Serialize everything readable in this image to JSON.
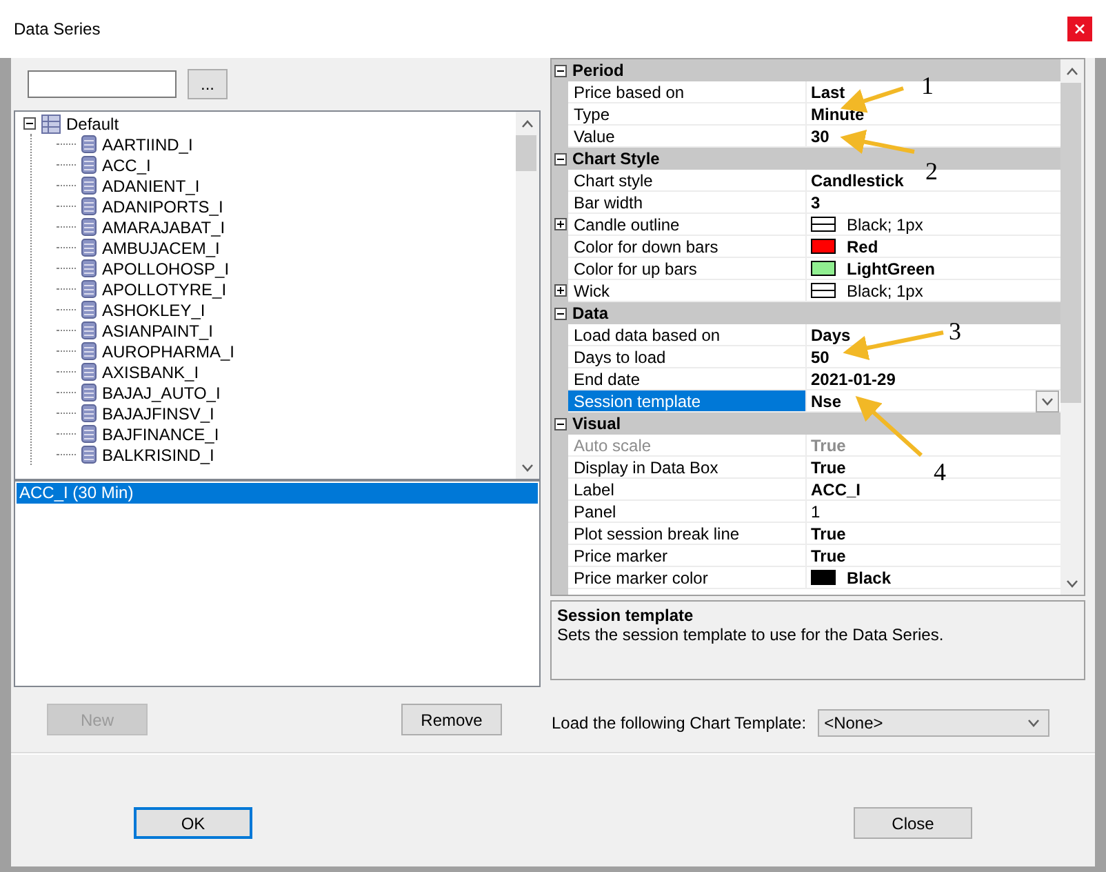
{
  "window": {
    "title": "Data Series"
  },
  "browse_button": "...",
  "tree": {
    "label": "Default",
    "expanded": true,
    "children": [
      {
        "label": "AARTIIND_I"
      },
      {
        "label": "ACC_I"
      },
      {
        "label": "ADANIENT_I"
      },
      {
        "label": "ADANIPORTS_I"
      },
      {
        "label": "AMARAJABAT_I"
      },
      {
        "label": "AMBUJACEM_I"
      },
      {
        "label": "APOLLOHOSP_I"
      },
      {
        "label": "APOLLOTYRE_I"
      },
      {
        "label": "ASHOKLEY_I"
      },
      {
        "label": "ASIANPAINT_I"
      },
      {
        "label": "AUROPHARMA_I"
      },
      {
        "label": "AXISBANK_I"
      },
      {
        "label": "BAJAJ_AUTO_I"
      },
      {
        "label": "BAJAJFINSV_I"
      },
      {
        "label": "BAJFINANCE_I"
      },
      {
        "label": "BALKRISIND_I"
      }
    ]
  },
  "series_list": [
    {
      "label": "ACC_I (30 Min)",
      "selected": true
    }
  ],
  "left_buttons": [
    {
      "label": "New",
      "disabled": true
    },
    {
      "label": "Remove",
      "disabled": false
    }
  ],
  "properties": [
    {
      "category": "Period",
      "expanded": true,
      "rows": [
        {
          "kind": "text",
          "name": "Price based on",
          "value": "Last",
          "bold": true,
          "disabled": false,
          "selected": false
        },
        {
          "kind": "text",
          "name": "Type",
          "value": "Minute",
          "bold": true,
          "disabled": false,
          "selected": false
        },
        {
          "kind": "text",
          "name": "Value",
          "value": "30",
          "bold": true,
          "disabled": false,
          "selected": false
        }
      ]
    },
    {
      "category": "Chart Style",
      "expanded": true,
      "rows": [
        {
          "kind": "text",
          "name": "Chart style",
          "value": "Candlestick",
          "bold": true,
          "disabled": false,
          "selected": false
        },
        {
          "kind": "text",
          "name": "Bar width",
          "value": "3",
          "bold": true,
          "disabled": false,
          "selected": false
        },
        {
          "kind": "pen",
          "name": "Candle outline",
          "value": "Black; 1px",
          "bold": false,
          "disabled": false,
          "selected": false,
          "expanded": false
        },
        {
          "kind": "color",
          "name": "Color for down bars",
          "value": "Red",
          "color": "#ff0000",
          "bold": true,
          "disabled": false,
          "selected": false
        },
        {
          "kind": "color",
          "name": "Color for up bars",
          "value": "LightGreen",
          "color": "#90ee90",
          "bold": true,
          "disabled": false,
          "selected": false
        },
        {
          "kind": "pen",
          "name": "Wick",
          "value": "Black; 1px",
          "bold": false,
          "disabled": false,
          "selected": false,
          "expanded": false
        }
      ]
    },
    {
      "category": "Data",
      "expanded": true,
      "rows": [
        {
          "kind": "text",
          "name": "Load data based on",
          "value": "Days",
          "bold": true,
          "disabled": false,
          "selected": false
        },
        {
          "kind": "text",
          "name": "Days to load",
          "value": "50",
          "bold": true,
          "disabled": false,
          "selected": false
        },
        {
          "kind": "text",
          "name": "End date",
          "value": "2021-01-29",
          "bold": true,
          "disabled": false,
          "selected": false
        },
        {
          "kind": "dropdown",
          "name": "Session template",
          "value": "Nse",
          "bold": true,
          "disabled": false,
          "selected": true
        }
      ]
    },
    {
      "category": "Visual",
      "expanded": true,
      "rows": [
        {
          "kind": "text",
          "name": "Auto scale",
          "value": "True",
          "bold": true,
          "disabled": true,
          "selected": false
        },
        {
          "kind": "text",
          "name": "Display in Data Box",
          "value": "True",
          "bold": true,
          "disabled": false,
          "selected": false
        },
        {
          "kind": "text",
          "name": "Label",
          "value": "ACC_I",
          "bold": true,
          "disabled": false,
          "selected": false
        },
        {
          "kind": "text",
          "name": "Panel",
          "value": "1",
          "bold": false,
          "disabled": false,
          "selected": false
        },
        {
          "kind": "text",
          "name": "Plot session break line",
          "value": "True",
          "bold": true,
          "disabled": false,
          "selected": false
        },
        {
          "kind": "text",
          "name": "Price marker",
          "value": "True",
          "bold": true,
          "disabled": false,
          "selected": false
        },
        {
          "kind": "color",
          "name": "Price marker color",
          "value": "Black",
          "color": "#000000",
          "bold": true,
          "disabled": false,
          "selected": false
        }
      ]
    }
  ],
  "description": {
    "title": "Session template",
    "text": "Sets the session template to use for the Data Series."
  },
  "chart_template": {
    "label": "Load the following Chart Template:",
    "value": "<None>"
  },
  "dialog_buttons": [
    {
      "label": "OK",
      "default": true
    },
    {
      "label": "Close",
      "default": false
    }
  ],
  "annotations": [
    {
      "label": "1"
    },
    {
      "label": "2"
    },
    {
      "label": "3"
    },
    {
      "label": "4"
    }
  ]
}
